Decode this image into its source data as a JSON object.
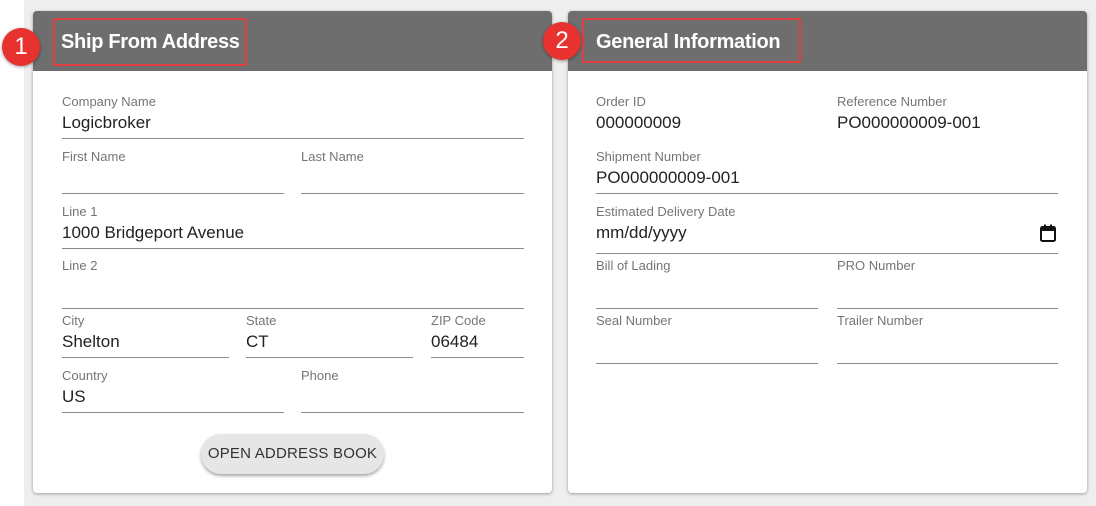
{
  "ship_from": {
    "marker": "1",
    "title": "Ship From Address",
    "company_name": {
      "label": "Company Name",
      "value": "Logicbroker"
    },
    "first_name": {
      "label": "First Name",
      "value": ""
    },
    "last_name": {
      "label": "Last Name",
      "value": ""
    },
    "line1": {
      "label": "Line 1",
      "value": "1000 Bridgeport Avenue"
    },
    "line2": {
      "label": "Line 2",
      "value": ""
    },
    "city": {
      "label": "City",
      "value": "Shelton"
    },
    "state": {
      "label": "State",
      "value": "CT"
    },
    "zip": {
      "label": "ZIP Code",
      "value": "06484"
    },
    "country": {
      "label": "Country",
      "value": "US"
    },
    "phone": {
      "label": "Phone",
      "value": ""
    },
    "address_book_button": "OPEN ADDRESS BOOK"
  },
  "general_info": {
    "marker": "2",
    "title": "General Information",
    "order_id": {
      "label": "Order ID",
      "value": "000000009"
    },
    "reference_number": {
      "label": "Reference Number",
      "value": "PO000000009-001"
    },
    "shipment_number": {
      "label": "Shipment Number",
      "value": "PO000000009-001"
    },
    "estimated_delivery_date": {
      "label": "Estimated Delivery Date",
      "placeholder": "mm/dd/yyyy",
      "icon": "calendar-icon"
    },
    "bill_of_lading": {
      "label": "Bill of Lading",
      "value": ""
    },
    "pro_number": {
      "label": "PRO Number",
      "value": ""
    },
    "seal_number": {
      "label": "Seal Number",
      "value": ""
    },
    "trailer_number": {
      "label": "Trailer Number",
      "value": ""
    }
  },
  "colors": {
    "header_bg": "#6e6e6e",
    "highlight": "#e04040",
    "marker_bg": "#e8322f",
    "page_bg": "#eeeeee"
  }
}
